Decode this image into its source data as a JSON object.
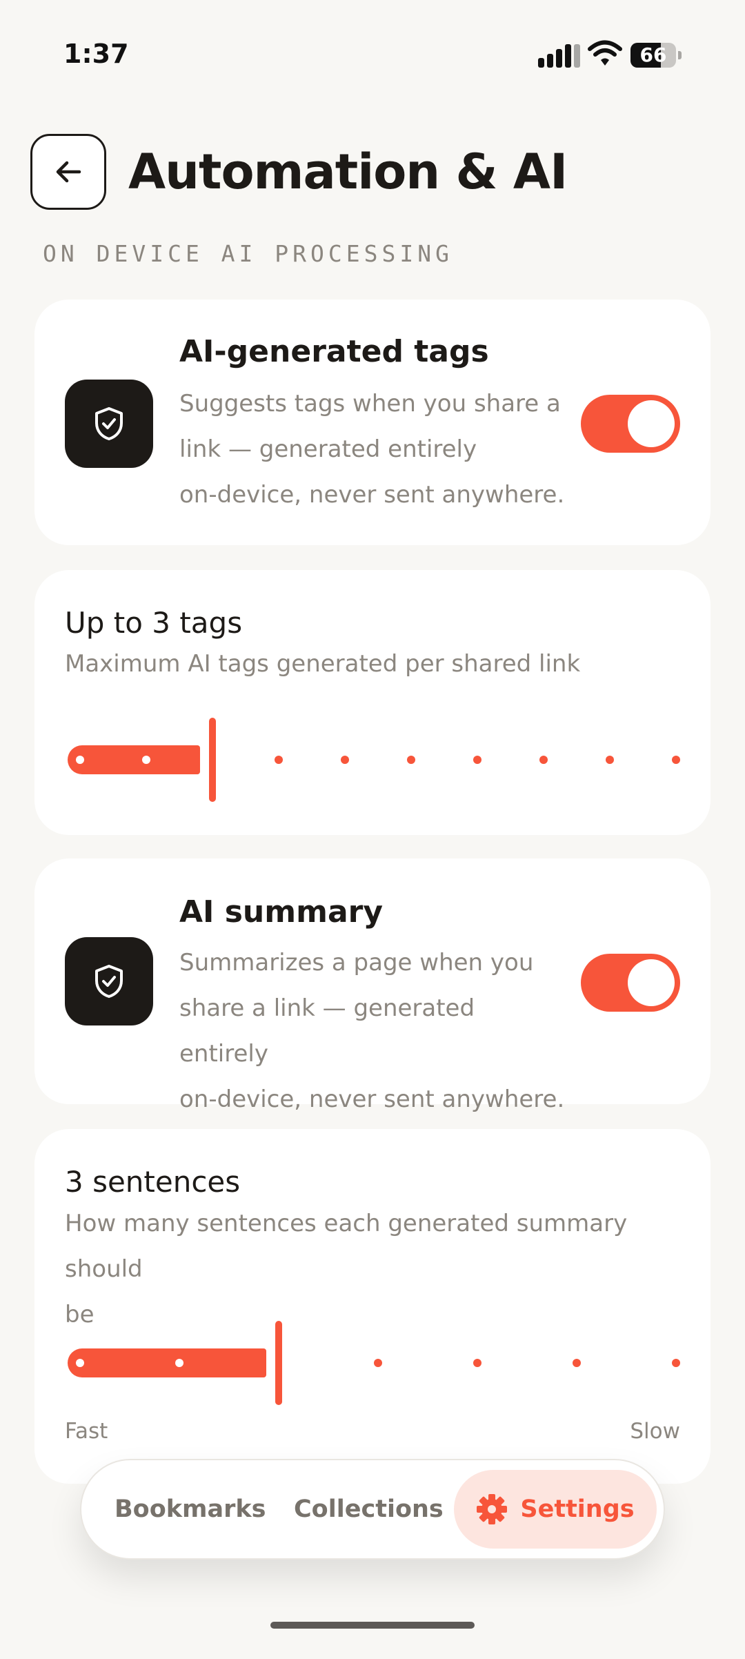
{
  "status_bar": {
    "time": "1:37",
    "battery_percent": 66,
    "battery_label": "66"
  },
  "header": {
    "title": "Automation & AI",
    "section_label": "ON DEVICE AI PROCESSING"
  },
  "cards": {
    "tags_toggle": {
      "title": "AI-generated tags",
      "description": [
        "Suggests tags when you share a",
        "link — generated entirely",
        "on-device, never sent anywhere."
      ],
      "enabled": true,
      "icon": "shield-check-icon"
    },
    "tags_slider": {
      "title": "Up to 3 tags",
      "description": "Maximum AI tags generated per shared link",
      "value": 3,
      "min": 1,
      "max": 10
    },
    "summary_toggle": {
      "title": "AI summary",
      "description": [
        "Summarizes a page when you",
        "share a link — generated entirely",
        "on-device, never sent anywhere."
      ],
      "enabled": true,
      "icon": "shield-check-icon"
    },
    "summary_slider": {
      "title": "3 sentences",
      "description": [
        "How many sentences each generated summary should",
        "be"
      ],
      "value": 3,
      "min": 1,
      "max": 7,
      "min_label": "Fast",
      "max_label": "Slow"
    }
  },
  "bottom_nav": {
    "items": [
      {
        "label": "Bookmarks",
        "active": false
      },
      {
        "label": "Collections",
        "active": false
      },
      {
        "label": "Settings",
        "active": true,
        "icon": "gear-icon"
      }
    ]
  },
  "colors": {
    "accent": "#f7553a",
    "accent_soft": "#fde5df",
    "background": "#f8f7f4",
    "card": "#ffffff",
    "text": "#1d1a17",
    "muted": "#8b867f"
  }
}
